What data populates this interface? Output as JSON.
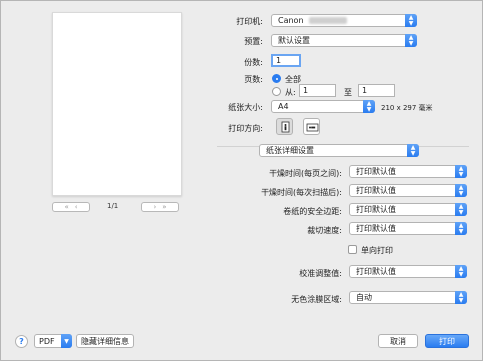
{
  "printer": {
    "label": "打印机:",
    "value": "Canon"
  },
  "presets": {
    "label": "预置:",
    "value": "默认设置"
  },
  "copies": {
    "label": "份数:",
    "value": "1"
  },
  "pages": {
    "label": "页数:",
    "all_label": "全部",
    "from_label": "从:",
    "from_value": "1",
    "to_label": "至",
    "to_value": "1"
  },
  "paper_size": {
    "label": "纸张大小:",
    "value": "A4",
    "dimensions": "210 x 297 毫米"
  },
  "orientation": {
    "label": "打印方向:"
  },
  "section": {
    "value": "纸张详细设置"
  },
  "settings": [
    {
      "label": "干燥时间(每页之间):",
      "value": "打印默认值"
    },
    {
      "label": "干燥时间(每次扫描后):",
      "value": "打印默认值"
    },
    {
      "label": "卷纸的安全边距:",
      "value": "打印默认值"
    },
    {
      "label": "裁切速度:",
      "value": "打印默认值"
    }
  ],
  "unidirectional": {
    "label": "单向打印"
  },
  "calibration": {
    "label": "校准调整值:",
    "value": "打印默认值"
  },
  "borderless": {
    "label": "无色涂膜区域:",
    "value": "自动"
  },
  "preview": {
    "page_indicator": "1/1"
  },
  "footer": {
    "help": "?",
    "pdf_label": "PDF",
    "hide_details": "隐藏详细信息",
    "cancel": "取消",
    "print": "打印"
  },
  "colors": {
    "accent": "#2a7cf0",
    "window_bg": "#ececec"
  }
}
